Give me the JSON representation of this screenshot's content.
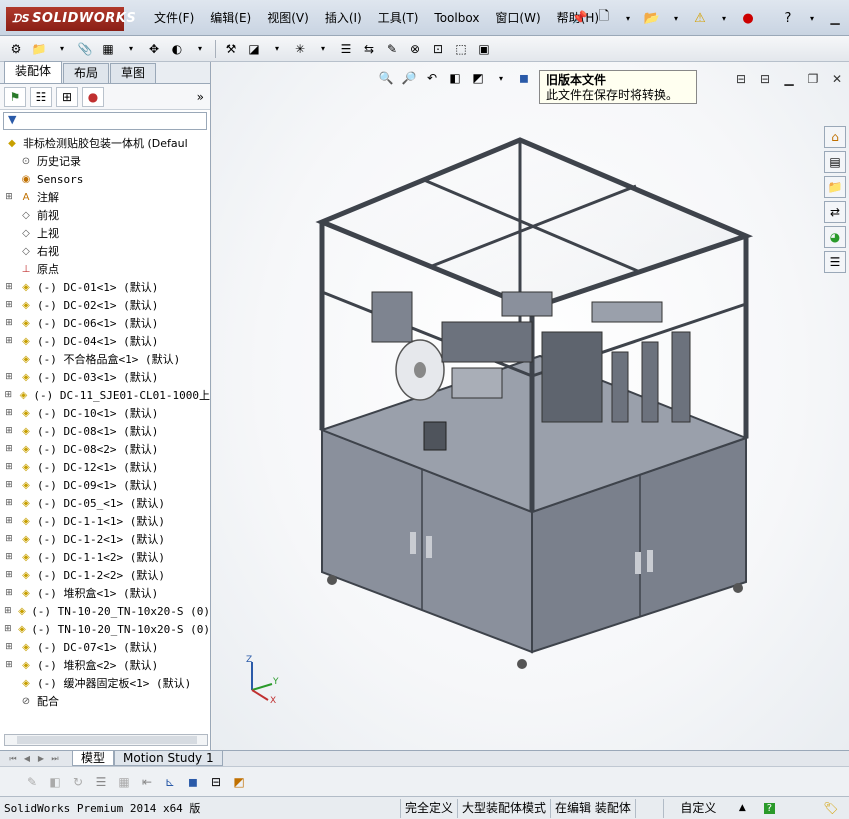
{
  "app": {
    "logo_text": "SOLIDWORKS",
    "menu": [
      "文件(F)",
      "编辑(E)",
      "视图(V)",
      "插入(I)",
      "工具(T)",
      "Toolbox",
      "窗口(W)",
      "帮助(H)"
    ]
  },
  "feature_manager": {
    "tabs": [
      "装配体",
      "布局",
      "草图"
    ],
    "active_tab": "装配体",
    "root": "非标检测贴胶包装一体机  (Defaul",
    "items": [
      {
        "label": "历史记录",
        "icon": "history-icon",
        "expand": false
      },
      {
        "label": "Sensors",
        "icon": "sensor-icon",
        "expand": false
      },
      {
        "label": "注解",
        "icon": "annotation-icon",
        "expand": true
      },
      {
        "label": "前视",
        "icon": "plane-icon",
        "expand": false
      },
      {
        "label": "上视",
        "icon": "plane-icon",
        "expand": false
      },
      {
        "label": "右视",
        "icon": "plane-icon",
        "expand": false
      },
      {
        "label": "原点",
        "icon": "origin-icon",
        "expand": false
      },
      {
        "label": "(-) DC-01<1> (默认)",
        "icon": "part-icon",
        "expand": true
      },
      {
        "label": "(-) DC-02<1> (默认)",
        "icon": "part-icon",
        "expand": true
      },
      {
        "label": "(-) DC-06<1> (默认)",
        "icon": "part-icon",
        "expand": true
      },
      {
        "label": "(-) DC-04<1> (默认)",
        "icon": "part-icon",
        "expand": true
      },
      {
        "label": "(-) 不合格品盒<1> (默认)",
        "icon": "part-icon",
        "expand": false
      },
      {
        "label": "(-) DC-03<1> (默认)",
        "icon": "part-icon",
        "expand": true
      },
      {
        "label": "(-) DC-11_SJE01-CL01-1000上",
        "icon": "part-icon",
        "expand": true
      },
      {
        "label": "(-) DC-10<1> (默认)",
        "icon": "part-icon",
        "expand": true
      },
      {
        "label": "(-) DC-08<1> (默认)",
        "icon": "part-icon",
        "expand": true
      },
      {
        "label": "(-) DC-08<2> (默认)",
        "icon": "part-icon",
        "expand": true
      },
      {
        "label": "(-) DC-12<1> (默认)",
        "icon": "part-icon",
        "expand": true
      },
      {
        "label": "(-) DC-09<1> (默认)",
        "icon": "part-icon",
        "expand": true
      },
      {
        "label": "(-) DC-05_<1> (默认)",
        "icon": "part-icon",
        "expand": true
      },
      {
        "label": "(-) DC-1-1<1> (默认)",
        "icon": "part-icon",
        "expand": true
      },
      {
        "label": "(-) DC-1-2<1> (默认)",
        "icon": "part-icon",
        "expand": true
      },
      {
        "label": "(-) DC-1-1<2> (默认)",
        "icon": "part-icon",
        "expand": true
      },
      {
        "label": "(-) DC-1-2<2> (默认)",
        "icon": "part-icon",
        "expand": true
      },
      {
        "label": "(-) 堆积盒<1> (默认)",
        "icon": "part-icon",
        "expand": true
      },
      {
        "label": "(-) TN-10-20_TN-10x20-S (0)",
        "icon": "part-icon",
        "expand": true
      },
      {
        "label": "(-) TN-10-20_TN-10x20-S (0)",
        "icon": "part-icon",
        "expand": true
      },
      {
        "label": "(-) DC-07<1> (默认)",
        "icon": "part-icon",
        "expand": true
      },
      {
        "label": "(-) 堆积盒<2> (默认)",
        "icon": "part-icon",
        "expand": true
      },
      {
        "label": "(-) 缓冲器固定板<1> (默认)",
        "icon": "part-icon",
        "expand": false
      },
      {
        "label": "配合",
        "icon": "mates-icon",
        "expand": false
      }
    ]
  },
  "bottom_tabs": [
    "模型",
    "Motion Study 1"
  ],
  "active_bottom_tab": "模型",
  "tooltip": {
    "title": "旧版本文件",
    "text": "此文件在保存时将转换。"
  },
  "triad": {
    "x": "X",
    "y": "Y",
    "z": "Z"
  },
  "status": {
    "version": "SolidWorks Premium 2014 x64 版",
    "cells": [
      "完全定义",
      "大型装配体模式",
      "在编辑 装配体",
      "",
      "自定义"
    ]
  },
  "colors": {
    "logo_red": "#b0392b",
    "frame": "#4a4f58",
    "panel": "#8c93a0",
    "accent_blue": "#2a5aa8"
  }
}
